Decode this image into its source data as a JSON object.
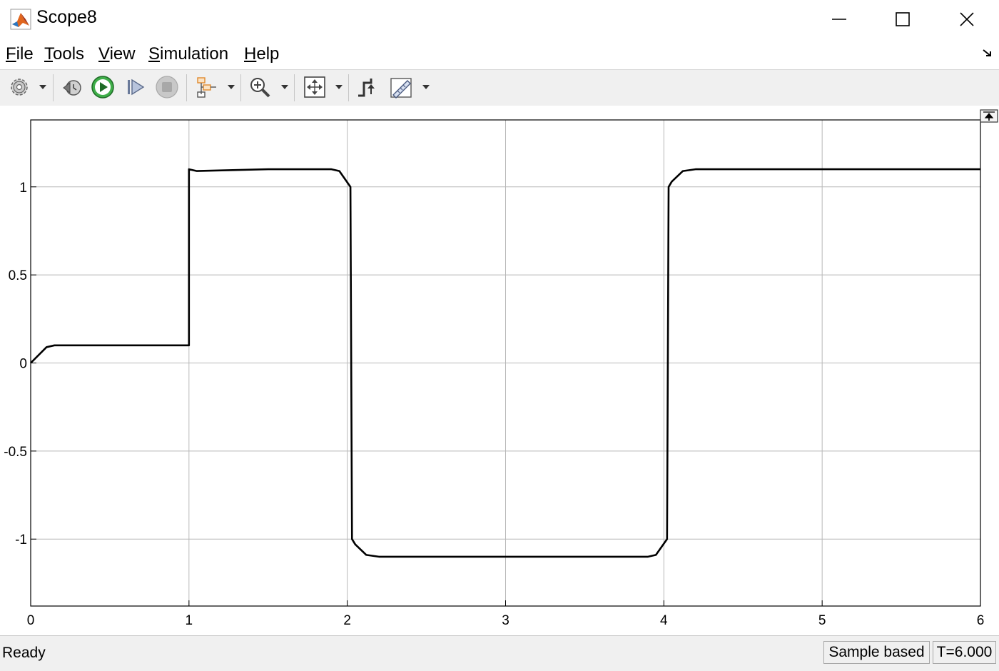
{
  "window": {
    "title": "Scope8"
  },
  "menu": [
    {
      "key": "F",
      "rest": "ile"
    },
    {
      "key": "T",
      "rest": "ools"
    },
    {
      "key": "V",
      "rest": "iew"
    },
    {
      "key": "S",
      "rest": "imulation"
    },
    {
      "key": "H",
      "rest": "elp"
    }
  ],
  "toolbar": {
    "icons": [
      "settings-gear-icon",
      "step-back-icon",
      "run-icon",
      "step-forward-icon",
      "stop-icon",
      "signal-highlight-icon",
      "zoom-in-icon",
      "autoscale-icon",
      "triggers-icon",
      "cursor-measurements-icon"
    ]
  },
  "status": {
    "left": "Ready",
    "mode": "Sample based",
    "time": "T=6.000"
  },
  "colors": {
    "line": "#000000",
    "grid": "#b8b8b8",
    "chrome": "#f0f0f0"
  },
  "chart_data": {
    "type": "line",
    "title": "",
    "xlabel": "",
    "ylabel": "",
    "xlim": [
      0,
      6
    ],
    "ylim": [
      -1.38,
      1.38
    ],
    "xticks": [
      0,
      1,
      2,
      3,
      4,
      5,
      6
    ],
    "yticks": [
      -1,
      -0.5,
      0,
      0.5,
      1
    ],
    "xtick_labels": [
      "0",
      "1",
      "2",
      "3",
      "4",
      "5",
      "6"
    ],
    "ytick_labels": [
      "-1",
      "-0.5",
      "0",
      "0.5",
      "1"
    ],
    "grid": true,
    "series": [
      {
        "x": [
          0,
          0.1,
          0.15,
          0.5,
          1.0,
          1.0,
          1.05,
          1.5,
          1.9,
          1.95,
          2.02,
          2.03,
          2.05,
          2.12,
          2.2,
          3.0,
          3.9,
          3.95,
          4.02,
          4.03,
          4.05,
          4.12,
          4.2,
          5.0,
          6.0
        ],
        "y": [
          0,
          0.09,
          0.1,
          0.1,
          0.1,
          1.1,
          1.09,
          1.1,
          1.1,
          1.09,
          1.0,
          -1.0,
          -1.03,
          -1.09,
          -1.1,
          -1.1,
          -1.1,
          -1.09,
          -1.0,
          1.0,
          1.03,
          1.09,
          1.1,
          1.1,
          1.1
        ]
      }
    ]
  }
}
